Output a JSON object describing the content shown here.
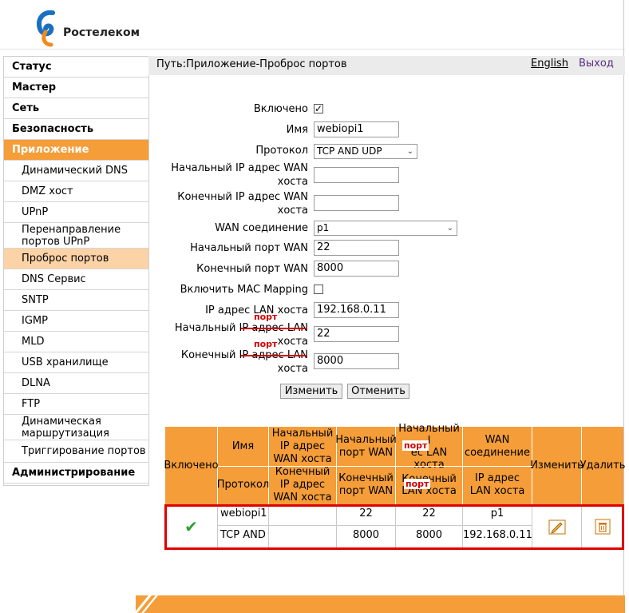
{
  "brand": {
    "name": "Ростелеком"
  },
  "sidebar": {
    "items": [
      {
        "label": "Статус",
        "type": "main"
      },
      {
        "label": "Мастер",
        "type": "main"
      },
      {
        "label": "Сеть",
        "type": "main"
      },
      {
        "label": "Безопасность",
        "type": "main"
      },
      {
        "label": "Приложение",
        "type": "main"
      },
      {
        "label": "Динамический DNS",
        "type": "sub"
      },
      {
        "label": "DMZ хост",
        "type": "sub"
      },
      {
        "label": "UPnP",
        "type": "sub"
      },
      {
        "label": "Перенаправление портов UPnP",
        "type": "sub"
      },
      {
        "label": "Проброс портов",
        "type": "sub"
      },
      {
        "label": "DNS Сервис",
        "type": "sub"
      },
      {
        "label": "SNTP",
        "type": "sub"
      },
      {
        "label": "IGMP",
        "type": "sub"
      },
      {
        "label": "MLD",
        "type": "sub"
      },
      {
        "label": "USB хранилище",
        "type": "sub"
      },
      {
        "label": "DLNA",
        "type": "sub"
      },
      {
        "label": "FTP",
        "type": "sub"
      },
      {
        "label": "Динамическая маршрутизация",
        "type": "sub"
      },
      {
        "label": "Триггирование портов",
        "type": "sub"
      },
      {
        "label": "Администрирование",
        "type": "main"
      }
    ]
  },
  "topbar": {
    "path": "Путь:Приложение-Проброс портов",
    "lang": "English",
    "logout": "Выход"
  },
  "form": {
    "enabled_label": "Включено",
    "name_label": "Имя",
    "name_value": "webiopi1",
    "protocol_label": "Протокол",
    "protocol_value": "TCP AND UDP",
    "wan_start_ip_label": "Начальный IP адрес WAN хоста",
    "wan_start_ip_value": "",
    "wan_end_ip_label": "Конечный IP адрес WAN хоста",
    "wan_end_ip_value": "",
    "wan_conn_label": "WAN соединение",
    "wan_conn_value": "p1",
    "wan_start_port_label": "Начальный порт WAN",
    "wan_start_port_value": "22",
    "wan_end_port_label": "Конечный порт WAN",
    "wan_end_port_value": "8000",
    "mac_mapping_label": "Включить MAC Mapping",
    "lan_ip_label": "IP адрес LAN хоста",
    "lan_ip_value": "192.168.0.11",
    "lan_start_label": "Начальный IP адрес LAN хоста",
    "lan_start_value": "22",
    "lan_end_label": "Конечный IP адрес LAN хоста",
    "lan_end_value": "8000",
    "annotation": "порт",
    "modify_button": "Изменить",
    "cancel_button": "Отменить"
  },
  "table": {
    "headers": {
      "enabled": "Включено",
      "name": "Имя",
      "protocol": "Протокол",
      "wan_start_ip": "Начальный IP адрес WAN хоста",
      "wan_end_ip": "Конечный IP адрес WAN хоста",
      "wan_start_port": "Начальный порт WAN",
      "wan_end_port": "Конечный порт WAN",
      "lan_start_a": "Начальный I",
      "lan_start_b": "ес LAN хоста",
      "lan_end_a": "Конечный",
      "lan_end_b": "LAN хоста",
      "wan_conn": "WAN соединение",
      "lan_ip": "IP адрес LAN хоста",
      "modify": "Изменить",
      "delete": "Удалить"
    },
    "rows": [
      {
        "name": "webiopi1",
        "protocol": "TCP AND",
        "wan_start_ip": "",
        "wan_end_ip": "",
        "wan_start_port": "22",
        "wan_end_port": "8000",
        "lan_start": "22",
        "lan_end": "8000",
        "wan_conn": "p1",
        "lan_ip": "192.168.0.11"
      }
    ]
  },
  "colors": {
    "accent": "#f59d38",
    "accent_light": "#fbd3a6",
    "highlight_box": "#e00000",
    "annotation": "#d00000"
  }
}
